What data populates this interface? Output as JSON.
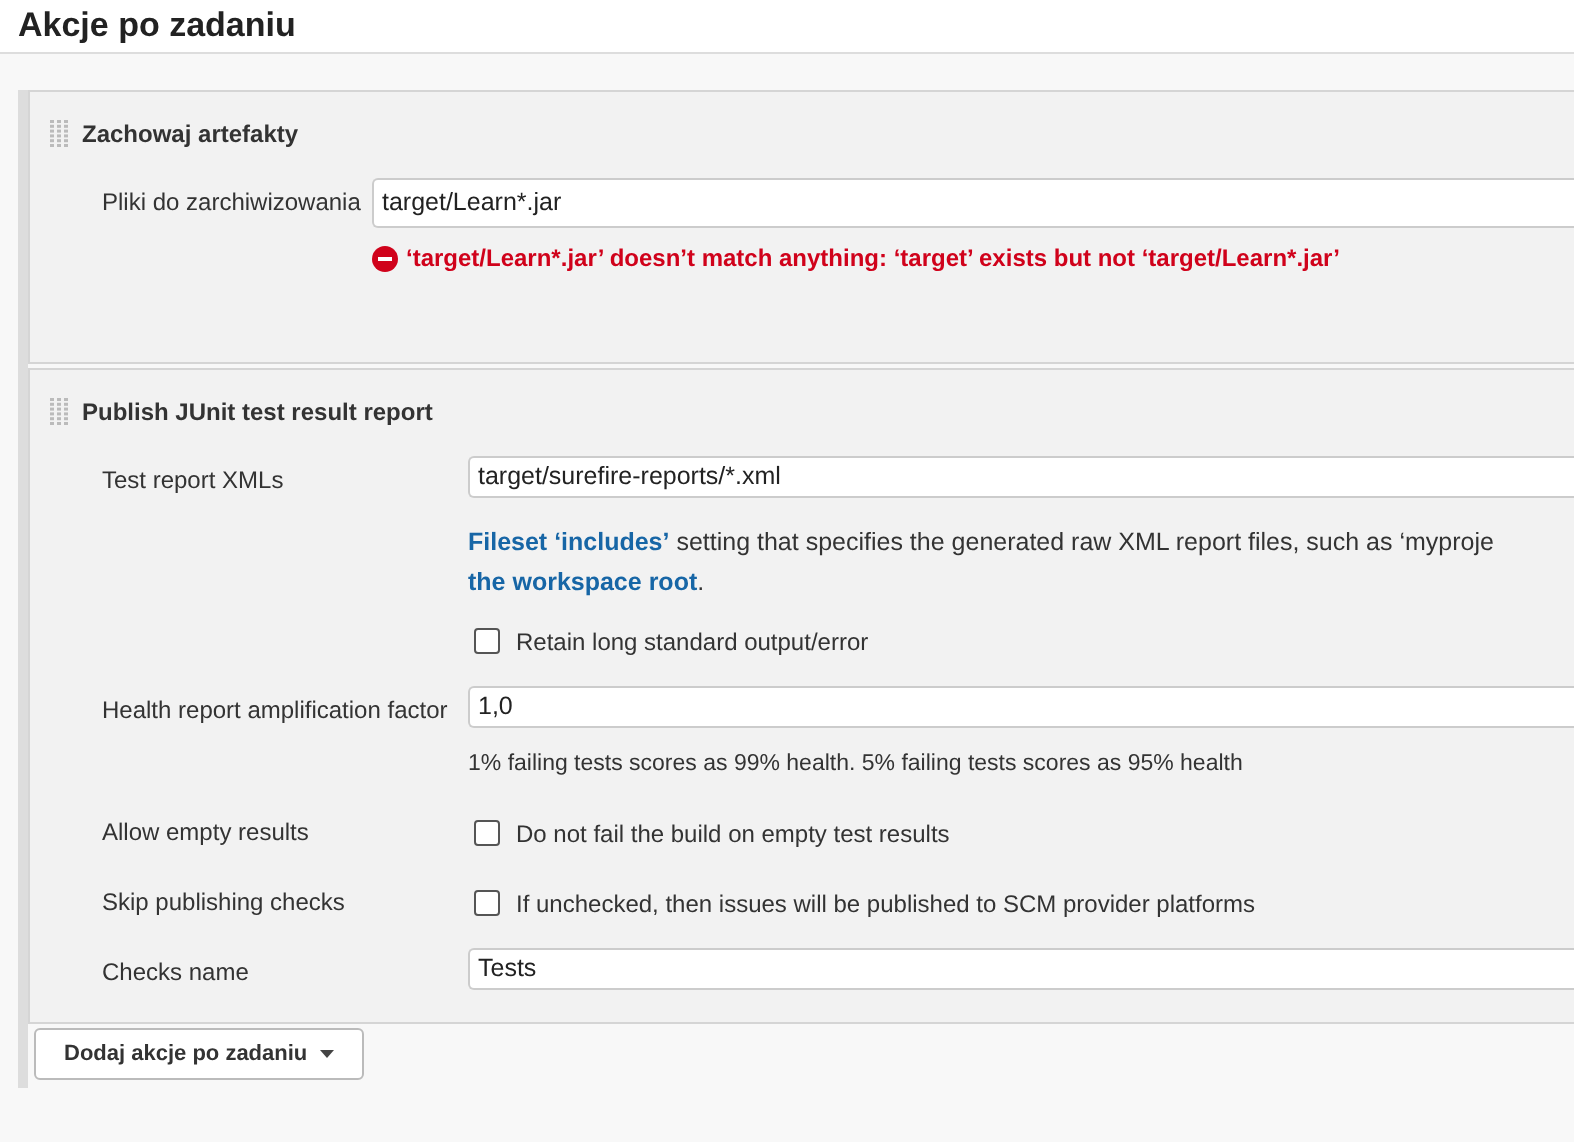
{
  "page_title": "Akcje po zadaniu",
  "archive_section": {
    "title": "Zachowaj artefakty",
    "label": "Pliki do zarchiwizowania",
    "value": "target/Learn*.jar",
    "error": "‘target/Learn*.jar’ doesn’t match anything: ‘target’ exists but not ‘target/Learn*.jar’"
  },
  "junit_section": {
    "title": "Publish JUnit test result report",
    "fields": [
      {
        "kind": "text",
        "label": "Test report XMLs",
        "value": "target/surefire-reports/*.xml",
        "help": {
          "link1": "Fileset ‘includes’",
          "text": " setting that specifies the generated raw XML report files, such as ‘myproje",
          "link2": "the workspace root",
          "tail": "."
        },
        "checkbox": {
          "label": "Retain long standard output/error",
          "checked": false
        }
      },
      {
        "kind": "text",
        "label": "Health report amplification factor",
        "value": "1,0",
        "note": "1% failing tests scores as 99% health. 5% failing tests scores as 95% health"
      },
      {
        "kind": "checkbox",
        "label": "Allow empty results",
        "checkbox": {
          "label": "Do not fail the build on empty test results",
          "checked": false
        }
      },
      {
        "kind": "checkbox",
        "label": "Skip publishing checks",
        "checkbox": {
          "label": "If unchecked, then issues will be published to SCM provider platforms",
          "checked": false
        }
      },
      {
        "kind": "text",
        "label": "Checks name",
        "value": "Tests"
      }
    ]
  },
  "add_button": "Dodaj akcje po zadaniu"
}
